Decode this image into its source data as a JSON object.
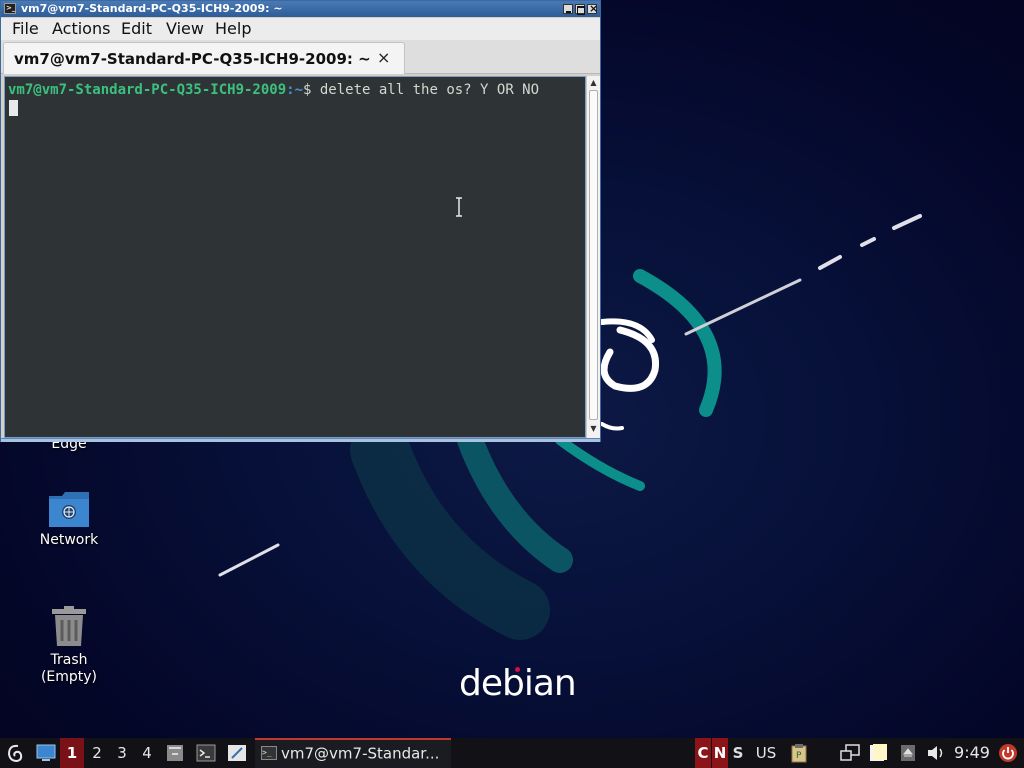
{
  "terminal": {
    "window_title": "vm7@vm7-Standard-PC-Q35-ICH9-2009: ~",
    "menu": [
      "File",
      "Actions",
      "Edit",
      "View",
      "Help"
    ],
    "tab_label": "vm7@vm7-Standard-PC-Q35-ICH9-2009: ~",
    "tab_close": "×",
    "prompt_user_host": "vm7@vm7-Standard-PC-Q35-ICH9-2009",
    "prompt_path": ":~",
    "prompt_symbol": "$",
    "command_text": " delete all the os? Y OR NO"
  },
  "desktop": {
    "icons": [
      {
        "label": "Edge",
        "icon": "edge-browser-icon"
      },
      {
        "label": "Network",
        "icon": "network-folder-icon"
      },
      {
        "label": "Trash\n(Empty)",
        "icon": "trash-icon"
      }
    ],
    "wallpaper_text": "debian",
    "wallpaper_accent": "#0c8f8a"
  },
  "taskbar": {
    "workspaces": [
      "1",
      "2",
      "3",
      "4"
    ],
    "active_workspace": "1",
    "task_label": "vm7@vm7-Standar...",
    "kb_indicators": [
      "C",
      "N",
      "S"
    ],
    "kb_layout": "US",
    "clock": "9:49",
    "accent": "#8a1418"
  }
}
